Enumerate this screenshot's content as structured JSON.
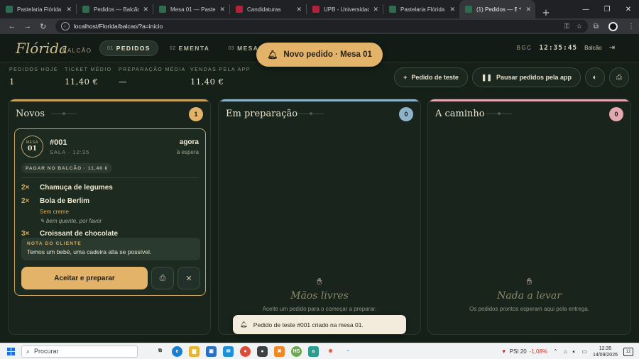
{
  "browser": {
    "tabs": [
      {
        "title": "Pastelaria Flórida — B",
        "favicon_color": "#2e6b4f",
        "active": false
      },
      {
        "title": "Pedidos — Balcão Flo",
        "favicon_color": "#2e6b4f",
        "active": false
      },
      {
        "title": "Mesa 01 — Pastelaria",
        "favicon_color": "#2e6b4f",
        "active": false
      },
      {
        "title": "Candidaturas",
        "favicon_color": "#b5203a",
        "active": false
      },
      {
        "title": "UPB - Universidade P",
        "favicon_color": "#b5203a",
        "active": false
      },
      {
        "title": "Pastelaria Flórida — B",
        "favicon_color": "#2e6b4f",
        "active": false
      },
      {
        "title": "(1) Pedidos — Ba",
        "favicon_color": "#2e6b4f",
        "active": true
      }
    ],
    "url": "localhost/Florida/balcao/?a=inicio"
  },
  "app": {
    "logo": "Flórida",
    "logo_sub": "BALCÃO",
    "nav": [
      {
        "num": "01",
        "label": "PEDIDOS",
        "active": true
      },
      {
        "num": "02",
        "label": "EMENTA",
        "active": false
      },
      {
        "num": "03",
        "label": "MESAS",
        "active": false
      }
    ],
    "alert": "Novo pedido · Mesa 01",
    "clock_label": "BGC",
    "clock": "12:35:45",
    "station": "Balcão"
  },
  "stats": [
    {
      "label": "PEDIDOS HOJE",
      "value": "1"
    },
    {
      "label": "TICKET MÉDIO",
      "value": "11,40 €"
    },
    {
      "label": "PREPARAÇÃO MÉDIA",
      "value": "—"
    },
    {
      "label": "VENDAS PELA APP",
      "value": "11,40 €"
    }
  ],
  "actions": {
    "test_order": "Pedido de teste",
    "pause": "Pausar pedidos pela app"
  },
  "columns": {
    "new": {
      "title": "Novos",
      "count": "1",
      "accent": "#c9a25c"
    },
    "prep": {
      "title": "Em preparação",
      "count": "0",
      "accent": "#8fb3c9",
      "empty_title": "Mãos livres",
      "empty_sub": "Aceite um pedido para o começar a preparar."
    },
    "road": {
      "title": "A caminho",
      "count": "0",
      "accent": "#e3a8b0",
      "empty_title": "Nada a levar",
      "empty_sub": "Os pedidos prontos esperam aqui pela entrega."
    }
  },
  "order": {
    "table_label": "MESA",
    "table_num": "01",
    "number": "#001",
    "meta": "SALA · 12:35",
    "when": "agora",
    "status": "à espera",
    "payment": "PAGAR NO BALCÃO · 11,40 €",
    "items": [
      {
        "qty": "2×",
        "name": "Chamuça de legumes"
      },
      {
        "qty": "2×",
        "name": "Bola de Berlim",
        "modifier": "Sem creme",
        "note": "bem quente, por favor"
      },
      {
        "qty": "3×",
        "name": "Croissant de chocolate"
      }
    ],
    "client_note_label": "NOTA DO CLIENTE",
    "client_note": "Temos um bebé, uma cadeira alta se possível.",
    "accept_label": "Aceitar e preparar"
  },
  "toast": "Pedido de teste #001 criado na mesa 01.",
  "taskbar": {
    "search_placeholder": "Procurar",
    "ticker_name": "PSI 20",
    "ticker_change": "-1,08%",
    "time": "12:35",
    "date": "14/09/2026",
    "notifications": "12"
  }
}
